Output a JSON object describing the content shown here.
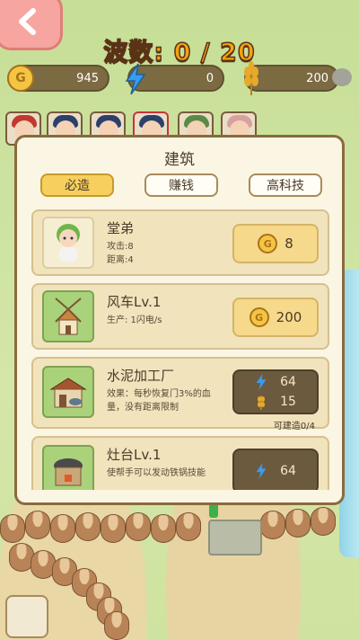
{
  "hud": {
    "back_icon": "chevron-left-icon",
    "wave_label": "波数",
    "wave_value": "0 / 20",
    "coins": "945",
    "energy": "0",
    "wheat": "200"
  },
  "modal": {
    "title": "建筑",
    "tabs": [
      "必造",
      "赚钱",
      "高科技"
    ],
    "active_tab": 0,
    "items": [
      {
        "name": "堂弟",
        "desc_lines": [
          "攻击:8",
          "距离:4"
        ],
        "cost_coin": "8",
        "icon": "baby-icon"
      },
      {
        "name": "风车Lv.1",
        "desc_lines": [
          "生产: 1闪电/s"
        ],
        "cost_coin": "200",
        "icon": "windmill-icon"
      },
      {
        "name": "水泥加工厂",
        "desc_lines": [
          "效果：每秒恢复门3%的血",
          "量，没有距离限制"
        ],
        "cost_energy": "64",
        "cost_wheat": "15",
        "buildable": "可建造0/4",
        "icon": "factory-icon"
      },
      {
        "name": "灶台Lv.1",
        "desc_lines": [
          "使帮手可以发动铁锅技能"
        ],
        "cost_energy": "64",
        "icon": "stove-icon"
      }
    ]
  },
  "colors": {
    "accent": "#f6a20e",
    "tab_active": "#f6cf5e",
    "panel": "#fbf6e3"
  }
}
